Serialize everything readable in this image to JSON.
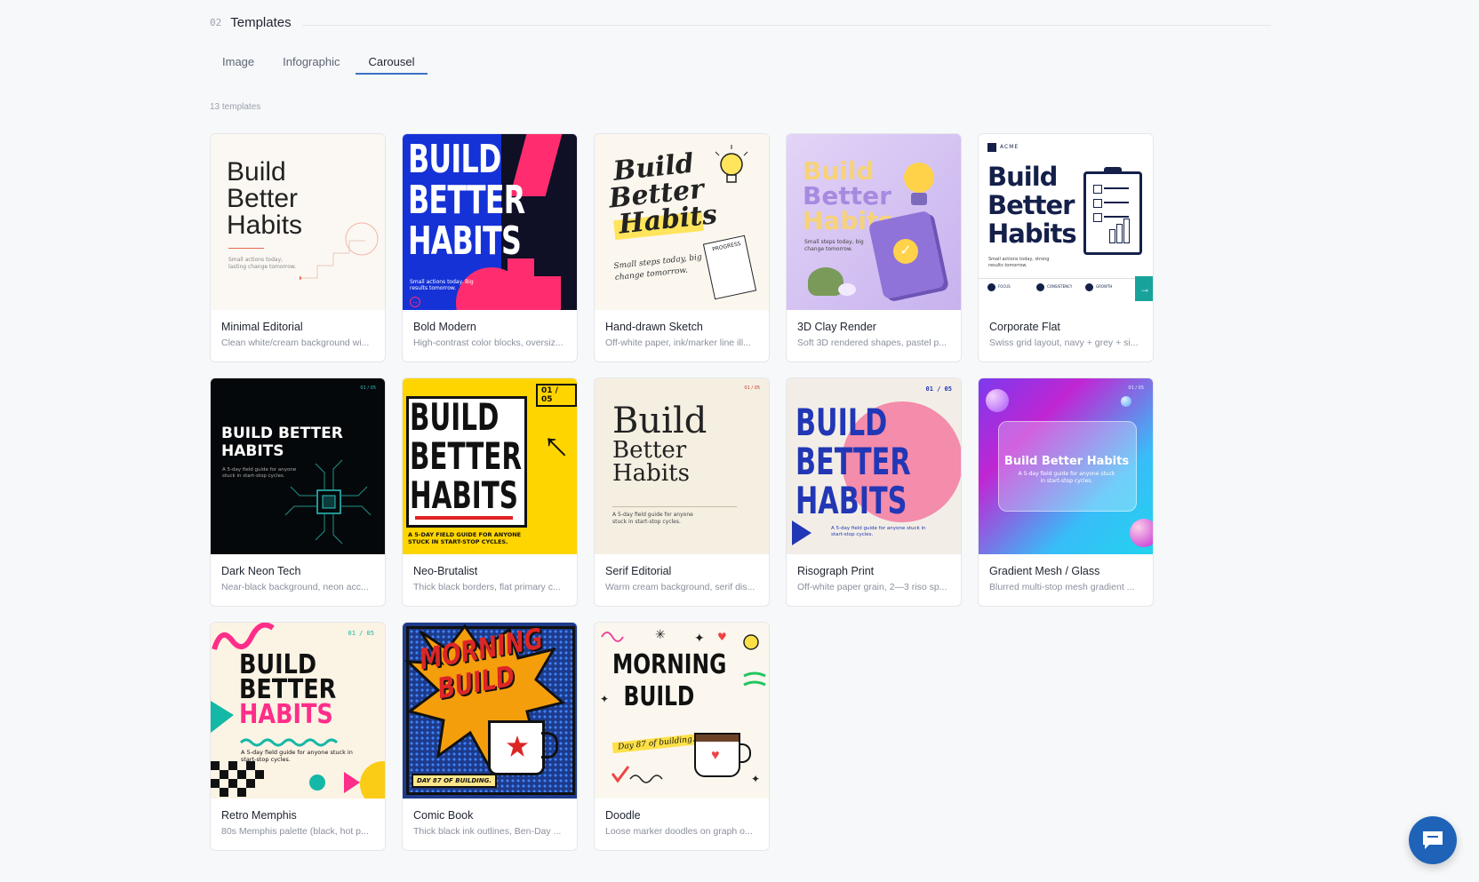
{
  "section": {
    "number": "02",
    "title": "Templates"
  },
  "tabs": [
    {
      "label": "Image",
      "active": false
    },
    {
      "label": "Infographic",
      "active": false
    },
    {
      "label": "Carousel",
      "active": true
    }
  ],
  "count_label": "13 templates",
  "templates": [
    {
      "name": "Minimal Editorial",
      "desc": "Clean white/cream background wi...",
      "thumb": {
        "line1": "Build",
        "line2": "Better",
        "line3": "Habits",
        "sub": "Small actions today, lasting change tomorrow."
      }
    },
    {
      "name": "Bold Modern",
      "desc": "High-contrast color blocks, oversiz...",
      "thumb": {
        "line1": "BUILD",
        "line2": "BETTER",
        "line3": "HABITS",
        "sub": "Small actions today. Big results tomorrow."
      }
    },
    {
      "name": "Hand-drawn Sketch",
      "desc": "Off-white paper, ink/marker line ill...",
      "thumb": {
        "line1": "Build",
        "line2": "Better",
        "line3": "Habits",
        "sub": "Small steps today, big change tomorrow.",
        "note": "PROGRESS"
      }
    },
    {
      "name": "3D Clay Render",
      "desc": "Soft 3D rendered shapes, pastel p...",
      "thumb": {
        "line1": "Build",
        "line2": "Better",
        "line3": "Habits",
        "sub": "Small steps today, big change tomorrow."
      }
    },
    {
      "name": "Corporate Flat",
      "desc": "Swiss grid layout, navy + grey + si...",
      "thumb": {
        "brand": "ACME",
        "line1": "Build",
        "line2": "Better",
        "line3": "Habits",
        "sub": "Small actions today, strong results tomorrow.",
        "f1": "FOCUS",
        "f2": "CONSISTENCY",
        "f3": "GROWTH"
      }
    },
    {
      "name": "Dark Neon Tech",
      "desc": "Near-black background, neon acc...",
      "thumb": {
        "page": "01 / 05",
        "line1": "BUILD BETTER",
        "line2": "HABITS",
        "sub": "A 5-day field guide for anyone stuck in start-stop cycles."
      }
    },
    {
      "name": "Neo-Brutalist",
      "desc": "Thick black borders, flat primary c...",
      "thumb": {
        "page": "01 / 05",
        "line1": "BUILD",
        "line2": "BETTER",
        "line3": "HABITS",
        "sub": "A 5-DAY FIELD GUIDE FOR ANYONE STUCK IN START-STOP CYCLES."
      }
    },
    {
      "name": "Serif Editorial",
      "desc": "Warm cream background, serif dis...",
      "thumb": {
        "page": "01 / 05",
        "line1": "Build",
        "line2": "Better",
        "line3": "Habits",
        "sub": "A 5-day field guide for anyone stuck in start-stop cycles."
      }
    },
    {
      "name": "Risograph Print",
      "desc": "Off-white paper grain, 2—3 riso sp...",
      "thumb": {
        "page": "01 / 05",
        "line1": "BUILD",
        "line2": "BETTER",
        "line3": "HABITS",
        "sub": "A 5-day field guide for anyone stuck in start-stop cycles."
      }
    },
    {
      "name": "Gradient Mesh / Glass",
      "desc": "Blurred multi-stop mesh gradient ...",
      "thumb": {
        "page": "01 / 05",
        "line1": "Build Better Habits",
        "sub": "A 5-day field guide for anyone stuck in start-stop cycles."
      }
    },
    {
      "name": "Retro Memphis",
      "desc": "80s Memphis palette (black, hot p...",
      "thumb": {
        "page": "01 / 05",
        "line1": "BUILD",
        "line2": "BETTER",
        "line3": "HABITS",
        "sub": "A 5-day field guide for anyone stuck in start-stop cycles."
      }
    },
    {
      "name": "Comic Book",
      "desc": "Thick black ink outlines, Ben-Day ...",
      "thumb": {
        "line1": "MORNING",
        "line2": "BUILD",
        "sub": "DAY 87 OF BUILDING."
      }
    },
    {
      "name": "Doodle",
      "desc": "Loose marker doodles on graph o...",
      "thumb": {
        "line1": "MORNING",
        "line2": "BUILD",
        "sub": "Day 87 of building."
      }
    }
  ],
  "colors": {
    "accent": "#3a72c4",
    "chat_button": "#1e63b8"
  }
}
